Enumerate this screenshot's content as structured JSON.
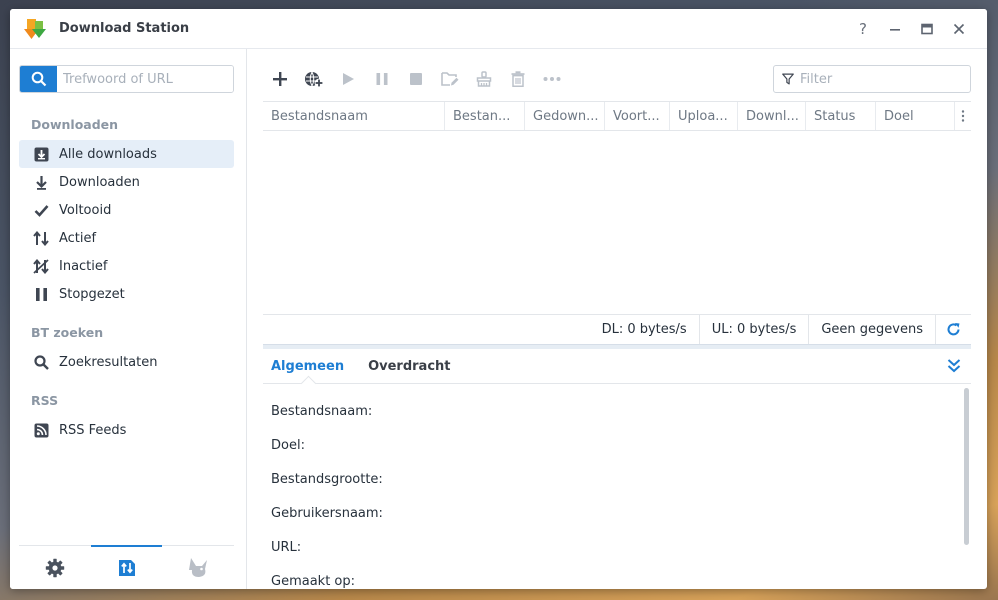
{
  "window": {
    "title": "Download Station",
    "controls": {
      "help": "?",
      "minimize": "—",
      "maximize": "▭",
      "close": "✕"
    }
  },
  "sidebar": {
    "search_placeholder": "Trefwoord of URL",
    "sections": [
      {
        "label": "Downloaden",
        "items": [
          {
            "label": "Alle downloads",
            "icon": "download-box-icon",
            "active": true
          },
          {
            "label": "Downloaden",
            "icon": "arrow-down-icon"
          },
          {
            "label": "Voltooid",
            "icon": "check-icon"
          },
          {
            "label": "Actief",
            "icon": "up-down-arrows-icon"
          },
          {
            "label": "Inactief",
            "icon": "inactive-icon"
          },
          {
            "label": "Stopgezet",
            "icon": "pause-icon"
          }
        ]
      },
      {
        "label": "BT zoeken",
        "items": [
          {
            "label": "Zoekresultaten",
            "icon": "search-icon"
          }
        ]
      },
      {
        "label": "RSS",
        "items": [
          {
            "label": "RSS Feeds",
            "icon": "rss-icon"
          }
        ]
      }
    ],
    "footer": [
      "gear-icon",
      "transfer-icon",
      "emule-icon"
    ]
  },
  "toolbar": {
    "buttons": [
      "add-icon",
      "add-url-icon",
      "play-icon",
      "pause-icon",
      "stop-icon",
      "edit-folder-icon",
      "clear-icon",
      "delete-icon",
      "more-icon"
    ],
    "filter_placeholder": "Filter"
  },
  "grid": {
    "columns": [
      "Bestandsnaam",
      "Bestan...",
      "Gedown...",
      "Voort...",
      "Uploa...",
      "Downl...",
      "Status",
      "Doel"
    ]
  },
  "status": {
    "dl": "DL: 0 bytes/s",
    "ul": "UL: 0 bytes/s",
    "info": "Geen gegevens"
  },
  "details": {
    "tabs": [
      {
        "label": "Algemeen",
        "active": true
      },
      {
        "label": "Overdracht"
      }
    ],
    "fields": [
      {
        "label": "Bestandsnaam:",
        "value": ""
      },
      {
        "label": "Doel:",
        "value": ""
      },
      {
        "label": "Bestandsgrootte:",
        "value": ""
      },
      {
        "label": "Gebruikersnaam:",
        "value": ""
      },
      {
        "label": "URL:",
        "value": ""
      },
      {
        "label": "Gemaakt op:",
        "value": ""
      }
    ]
  },
  "colors": {
    "accent": "#1e7ed3",
    "active_bg": "#e5eef8",
    "icon": "#3f4652"
  }
}
